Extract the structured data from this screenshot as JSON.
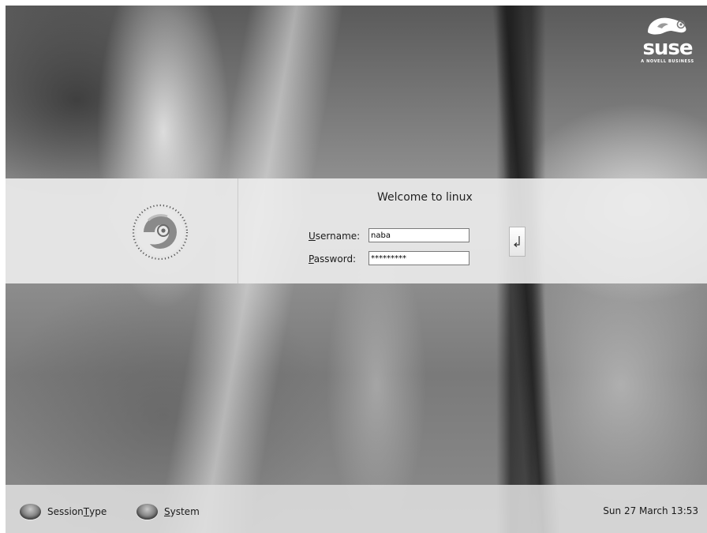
{
  "branding": {
    "logo_word": "suse",
    "logo_tagline": "A NOVELL BUSINESS"
  },
  "login": {
    "welcome": "Welcome to linux",
    "username_label_mnemonic": "U",
    "username_label_rest": "sername:",
    "username_value": "naba",
    "password_label_mnemonic": "P",
    "password_label_rest": "assword:",
    "password_value": "*********",
    "enter_icon": "return-arrow-icon"
  },
  "bottom_bar": {
    "session_type_pre": "Session ",
    "session_type_mnemonic": "T",
    "session_type_post": "ype",
    "system_mnemonic": "S",
    "system_post": "ystem",
    "clock": "Sun 27 March 13:53"
  },
  "colors": {
    "band": "#ececec",
    "text": "#222222",
    "logo": "#ffffff"
  }
}
